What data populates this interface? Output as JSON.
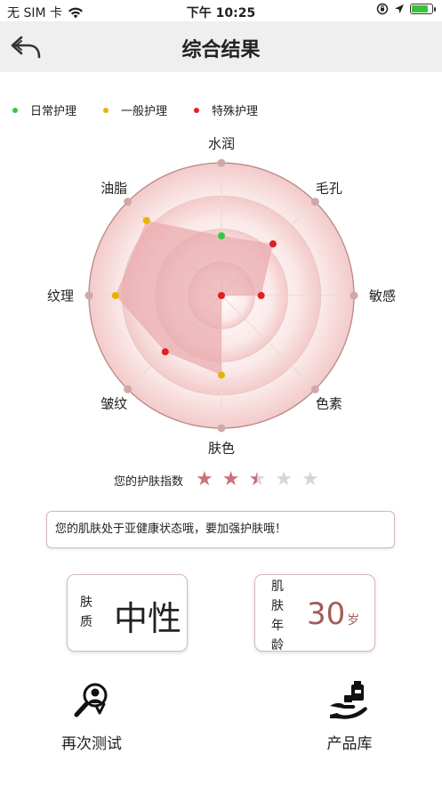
{
  "status_bar": {
    "carrier": "无 SIM 卡",
    "time": "下午 10:25",
    "battery_charging": true,
    "battery_level": 0.85
  },
  "navbar": {
    "title": "综合结果",
    "back_icon": "back-arrow-icon"
  },
  "legend": [
    {
      "label": "日常护理",
      "color": "#2ecc40"
    },
    {
      "label": "一般护理",
      "color": "#e6b400"
    },
    {
      "label": "特殊护理",
      "color": "#e02020"
    }
  ],
  "chart_data": {
    "type": "radar",
    "axes": [
      "水润",
      "毛孔",
      "敏感",
      "色素",
      "肤色",
      "皱纹",
      "纹理",
      "油脂"
    ],
    "values": [
      0.45,
      0.55,
      0.3,
      0.0,
      0.6,
      0.6,
      0.8,
      0.8
    ],
    "point_levels": [
      "日常护理",
      "特殊护理",
      "特殊护理",
      "特殊护理",
      "一般护理",
      "特殊护理",
      "一般护理",
      "一般护理"
    ],
    "range": [
      0,
      1
    ],
    "rings": 4,
    "fill_color": "#e9a8ab"
  },
  "skin_index": {
    "label": "您的护肤指数",
    "rating": 2.5,
    "max": 5
  },
  "advice": "您的肌肤处于亚健康状态哦，要加强护肤哦！",
  "skin_type_card": {
    "label_chars": [
      "肤",
      "质"
    ],
    "value": "中性"
  },
  "skin_age_card": {
    "label_chars": [
      "肌",
      "肤",
      "年",
      "龄"
    ],
    "age": "30",
    "unit": "岁"
  },
  "actions": {
    "retest": {
      "label": "再次测试",
      "icon": "retest-magnifier-icon"
    },
    "products": {
      "label": "产品库",
      "icon": "product-hand-icon"
    }
  }
}
